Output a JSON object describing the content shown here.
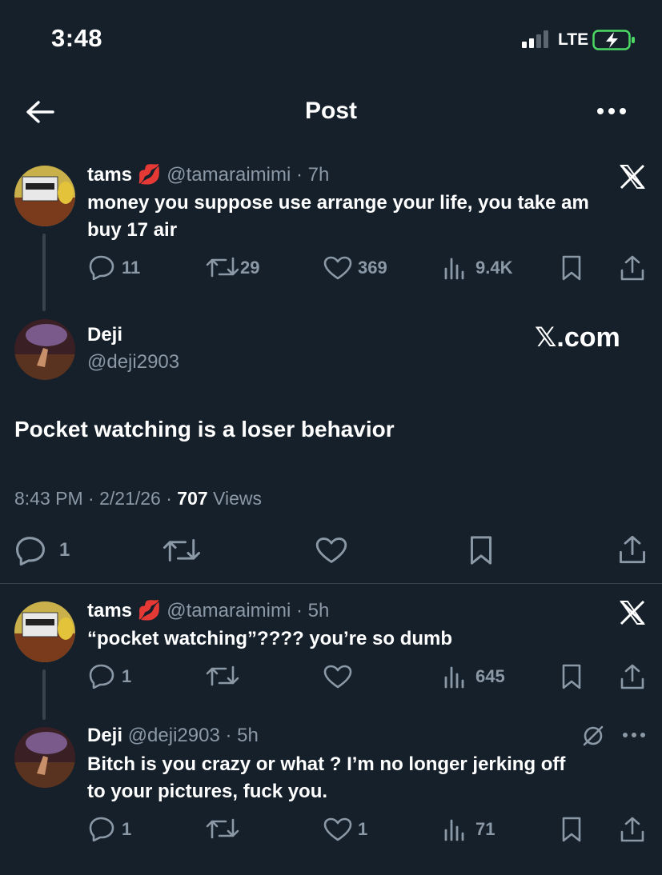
{
  "status_bar": {
    "time": "3:48",
    "network": "LTE"
  },
  "nav": {
    "title": "Post"
  },
  "parent_tweet": {
    "name": "tams",
    "handle": "@tamaraimimi",
    "time": "7h",
    "text_line1": "money you suppose use arrange your life, you take am",
    "text_line2": "buy 17 air",
    "replies": "11",
    "retweets": "29",
    "likes": "369",
    "views": "9.4K"
  },
  "main_tweet": {
    "name": "Deji",
    "handle": "@deji2903",
    "watermark": "𝕏.com",
    "text": "Pocket watching is a loser behavior",
    "timestamp": "8:43 PM · 2/21/26 · ",
    "views_count": "707",
    "views_label": " Views",
    "replies": "1"
  },
  "reply1": {
    "name": "tams",
    "handle": "@tamaraimimi",
    "time": "5h",
    "text": "“pocket watching”???? you’re so dumb",
    "replies": "1",
    "views": "645"
  },
  "reply2": {
    "name": "Deji",
    "handle": "@deji2903",
    "time": "5h",
    "text_line1": "Bitch is you crazy or what ? I’m no longer jerking off",
    "text_line2": "to your pictures, fuck you.",
    "replies": "1",
    "likes": "1",
    "views": "71"
  },
  "colors": {
    "background": "#15202b",
    "muted": "#8b98a5",
    "divider": "#38444d",
    "battery": "#4cd964"
  }
}
